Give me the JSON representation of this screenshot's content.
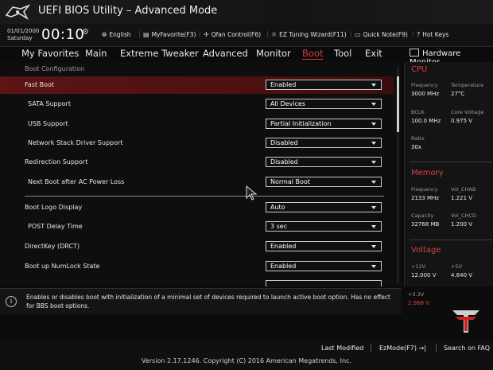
{
  "app": {
    "title": "UEFI BIOS Utility – Advanced Mode"
  },
  "clock": {
    "date": "01/01/2000",
    "day": "Saturday",
    "time": "00:10"
  },
  "quickbar": [
    {
      "label": "English",
      "icon": "globe-icon"
    },
    {
      "label": "MyFavorite(F3)",
      "icon": "favorite-list-icon"
    },
    {
      "label": "Qfan Control(F6)",
      "icon": "fan-icon"
    },
    {
      "label": "EZ Tuning Wizard(F11)",
      "icon": "bulb-icon"
    },
    {
      "label": "Quick Note(F9)",
      "icon": "note-icon"
    },
    {
      "label": "Hot Keys",
      "icon": "help-icon"
    }
  ],
  "menu": [
    "My Favorites",
    "Main",
    "Extreme Tweaker",
    "Advanced",
    "Monitor",
    "Boot",
    "Tool",
    "Exit"
  ],
  "active_menu": "Boot",
  "section_title": "Boot Configuration",
  "settings": [
    {
      "label": "Fast Boot",
      "value": "Enabled",
      "selected": true
    },
    {
      "label": "SATA Support",
      "value": "All Devices"
    },
    {
      "label": "USB Support",
      "value": "Partial Initialization"
    },
    {
      "label": "Network Stack Driver Support",
      "value": "Disabled"
    },
    {
      "label": "Redirection Support",
      "value": "Disabled"
    },
    {
      "label": "Next Boot after AC Power Loss",
      "value": "Normal Boot"
    },
    {
      "label": "Boot Logo Display",
      "value": "Auto"
    },
    {
      "label": "POST Delay Time",
      "value": "3 sec"
    },
    {
      "label": "DirectKey (DRCT)",
      "value": "Enabled"
    },
    {
      "label": "Boot up NumLock State",
      "value": "Enabled"
    }
  ],
  "hardware_monitor": {
    "title": "Hardware Monitor",
    "cpu": {
      "title": "CPU",
      "frequency_label": "Frequency",
      "frequency": "3000 MHz",
      "temperature_label": "Temperature",
      "temperature": "27°C",
      "bclk_label": "BCLK",
      "bclk": "100.0 MHz",
      "core_voltage_label": "Core Voltage",
      "core_voltage": "0.975 V",
      "ratio_label": "Ratio",
      "ratio": "30x"
    },
    "memory": {
      "title": "Memory",
      "frequency_label": "Frequency",
      "frequency": "2133 MHz",
      "vol_chab_label": "Vol_CHAB",
      "vol_chab": "1.221 V",
      "capacity_label": "Capacity",
      "capacity": "32768 MB",
      "vol_chcd_label": "Vol_CHCD",
      "vol_chcd": "1.200 V"
    },
    "voltage": {
      "title": "Voltage",
      "v12_label": "+12V",
      "v12": "12.000 V",
      "v5_label": "+5V",
      "v5": "4.840 V",
      "v33_label": "+3.3V",
      "v33": "2.968 V"
    }
  },
  "help_text": "Enables or disables boot with initialization of a minimal set of devices required to launch active boot option. Has no effect for BBS boot options.",
  "footer": {
    "last_modified": "Last Modified",
    "ezmode": "EzMode(F7)",
    "ezmode_icon": "→|",
    "search": "Search on FAQ",
    "version": "Version 2.17.1246. Copyright (C) 2016 American Megatrends, Inc."
  },
  "colors": {
    "accent": "#d93a3a",
    "selected_row": "#5c1414",
    "background": "#0b0b0b"
  }
}
